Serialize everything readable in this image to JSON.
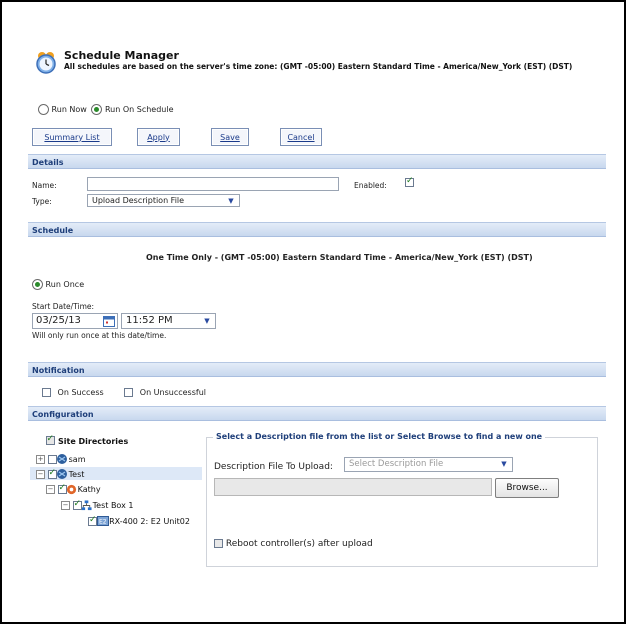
{
  "header": {
    "title": "Schedule Manager",
    "subtitle": "All schedules are based on the server's time zone: (GMT -05:00) Eastern Standard Time - America/New_York (EST) (DST)"
  },
  "run_mode": {
    "options": [
      {
        "label": "Run Now",
        "selected": false
      },
      {
        "label": "Run On Schedule",
        "selected": true
      }
    ]
  },
  "toolbar": {
    "summary_list_label": "Summary List",
    "apply_label": "Apply",
    "save_label": "Save",
    "cancel_label": "Cancel"
  },
  "details": {
    "section_title": "Details",
    "name_label": "Name:",
    "name_value": "",
    "enabled_label": "Enabled:",
    "enabled_checked": true,
    "type_label": "Type:",
    "type_value": "Upload Description File"
  },
  "schedule": {
    "section_title": "Schedule",
    "summary": "One Time Only - (GMT -05:00) Eastern Standard Time - America/New_York (EST) (DST)",
    "run_once_label": "Run Once",
    "start_label": "Start Date/Time:",
    "date_value": "03/25/13",
    "time_value": "11:52 PM",
    "note": "Will only run once at this date/time."
  },
  "notification": {
    "section_title": "Notification",
    "on_success_label": "On Success",
    "on_unsuccessful_label": "On Unsuccessful"
  },
  "configuration": {
    "section_title": "Configuration",
    "tree": {
      "root_label": "Site Directories",
      "items": [
        {
          "label": "sam",
          "checked": false
        },
        {
          "label": "Test",
          "checked": true
        },
        {
          "label": "Kathy",
          "checked": true
        },
        {
          "label": "Test Box 1",
          "checked": true
        },
        {
          "label": "RX-400 2: E2 Unit02",
          "checked": true
        }
      ]
    },
    "panel_legend": "Select a Description file from the list or Select Browse to find a new one",
    "upload_label": "Description File To Upload:",
    "upload_select_placeholder": "Select Description File",
    "browse_label": "Browse...",
    "reboot_label": "Reboot controller(s) after upload",
    "colors": {
      "section_header": "#c8d8ee",
      "section_text": "#1f3f7a",
      "selected_row": "#dde8f7"
    }
  }
}
